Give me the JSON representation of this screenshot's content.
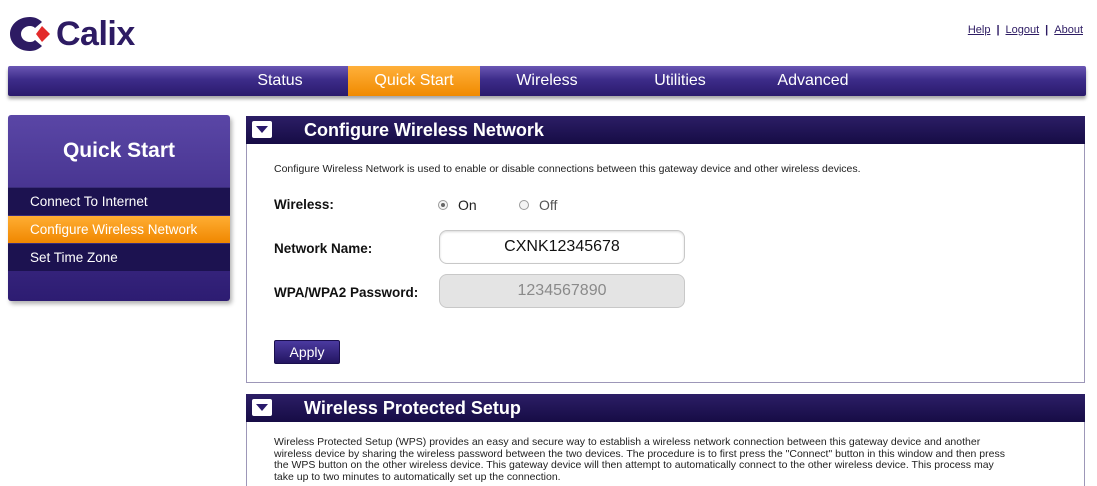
{
  "brand": {
    "name": "Calix",
    "primary": "#2d1b63",
    "accent": "#f08a00",
    "logo_red": "#e32b2b"
  },
  "toplinks": {
    "help": "Help",
    "logout": "Logout",
    "about": "About"
  },
  "nav": {
    "items": [
      {
        "label": "Status",
        "active": false
      },
      {
        "label": "Quick Start",
        "active": true
      },
      {
        "label": "Wireless",
        "active": false
      },
      {
        "label": "Utilities",
        "active": false
      },
      {
        "label": "Advanced",
        "active": false
      }
    ]
  },
  "sidebar": {
    "title": "Quick Start",
    "items": [
      {
        "label": "Connect To Internet",
        "active": false
      },
      {
        "label": "Configure Wireless Network",
        "active": true
      },
      {
        "label": "Set Time Zone",
        "active": false
      }
    ]
  },
  "config_panel": {
    "title": "Configure Wireless Network",
    "collapse_icon": "triangle-down-icon",
    "description": "Configure Wireless Network is used to enable or disable connections between this gateway device and other wireless devices.",
    "wireless_label": "Wireless:",
    "radio_on": "On",
    "radio_off": "Off",
    "wireless_state": "On",
    "network_name_label": "Network Name:",
    "network_name_value": "CXNK12345678",
    "password_label": "WPA/WPA2 Password:",
    "password_value": "1234567890",
    "apply_label": "Apply"
  },
  "wps_panel": {
    "title": "Wireless Protected Setup",
    "collapse_icon": "triangle-down-icon",
    "lines": [
      "Wireless Protected Setup (WPS) provides an easy and secure way to establish a wireless network connection between this gateway device and another",
      "wireless device by sharing the wireless password between the two devices.  The procedure is to first press the \"Connect\" button in this window and then press",
      "the WPS button on the other wireless device.  This gateway device will then attempt to automatically connect to the other wireless device.  This process may",
      "take up to two minutes to automatically set up the connection."
    ]
  }
}
